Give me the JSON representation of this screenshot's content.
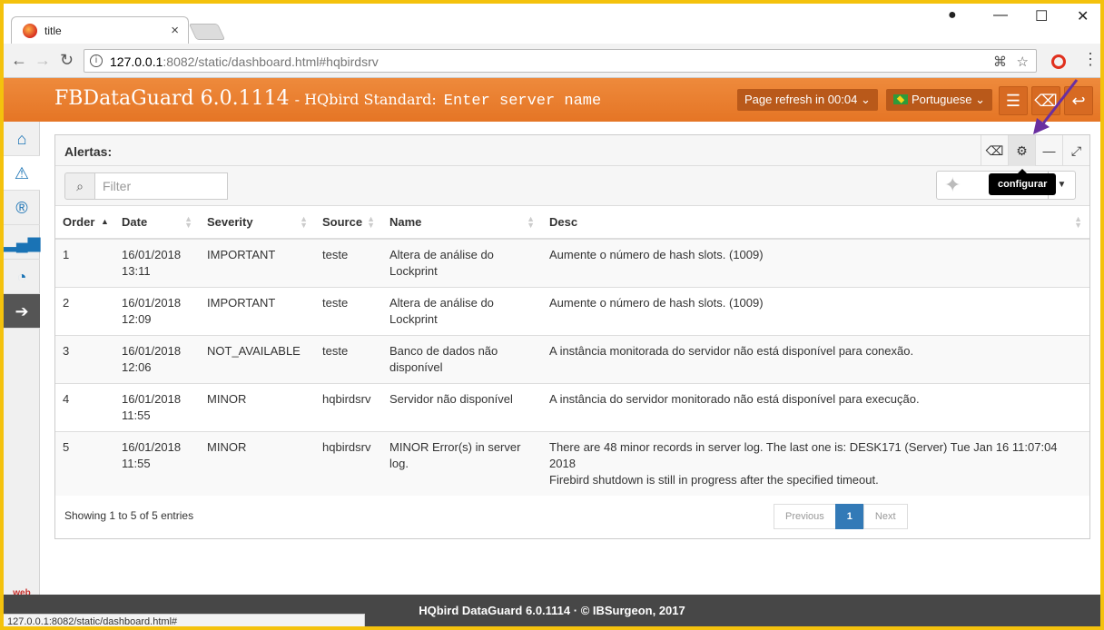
{
  "browser": {
    "tab_title": "title",
    "url_host": "127.0.0.1",
    "url_rest": ":8082/static/dashboard.html#hqbirdsrv",
    "status_url": "127.0.0.1:8082/static/dashboard.html#"
  },
  "header": {
    "app_name": "FBDataGuard 6.0.1114",
    "edition": "- HQbird Standard:",
    "server_name": "Enter server name",
    "refresh_label": "Page refresh in 00:04",
    "language": "Portuguese"
  },
  "sidebar": {
    "items": [
      "home-icon",
      "warning-icon",
      "registered-icon",
      "signal-icon",
      "dashboard-icon",
      "arrow-right-icon"
    ],
    "web_console": "web console"
  },
  "panel": {
    "title": "Alertas:",
    "tooltip": "configurar",
    "filter_placeholder": "Filter"
  },
  "table": {
    "columns": [
      "Order",
      "Date",
      "Severity",
      "Source",
      "Name",
      "Desc"
    ],
    "rows": [
      {
        "order": "1",
        "date": "16/01/2018",
        "time": "13:11",
        "severity": "IMPORTANT",
        "source": "teste",
        "name": "Altera de análise do Lockprint",
        "desc": "Aumente o número de hash slots. (1009)"
      },
      {
        "order": "2",
        "date": "16/01/2018",
        "time": "12:09",
        "severity": "IMPORTANT",
        "source": "teste",
        "name": "Altera de análise do Lockprint",
        "desc": "Aumente o número de hash slots. (1009)"
      },
      {
        "order": "3",
        "date": "16/01/2018",
        "time": "12:06",
        "severity": "NOT_AVAILABLE",
        "source": "teste",
        "name": "Banco de dados não disponível",
        "desc": "A instância monitorada do servidor não está disponível para conexão."
      },
      {
        "order": "4",
        "date": "16/01/2018",
        "time": "11:55",
        "severity": "MINOR",
        "source": "hqbirdsrv",
        "name": "Servidor não disponível",
        "desc": "A instância do servidor monitorado não está disponível para execução."
      },
      {
        "order": "5",
        "date": "16/01/2018",
        "time": "11:55",
        "severity": "MINOR",
        "source": "hqbirdsrv",
        "name": "MINOR Error(s) in server log.",
        "desc": "There are 48 minor records in server log. The last one is: DESK171 (Server) Tue Jan 16 11:07:04 2018",
        "desc2": "Firebird shutdown is still in progress after the specified timeout."
      }
    ],
    "info": "Showing 1 to 5 of 5 entries",
    "pager": {
      "previous": "Previous",
      "current": "1",
      "next": "Next"
    }
  },
  "footer": {
    "text": "HQbird DataGuard 6.0.1114 · © IBSurgeon, 2017"
  },
  "colors": {
    "header_orange": "#e57525",
    "accent_blue": "#337ab7",
    "footer_dark": "#474747",
    "annotation_arrow": "#6a2fa0"
  }
}
